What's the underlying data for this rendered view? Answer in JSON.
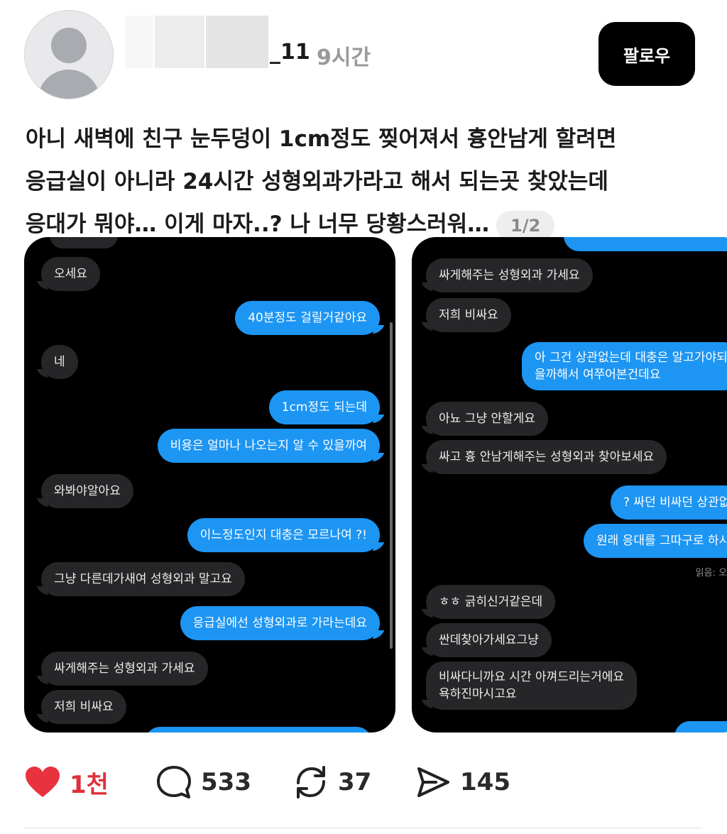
{
  "header": {
    "username": "_11",
    "time_ago": "9시간",
    "follow_label": "팔로우"
  },
  "post": {
    "lines": [
      "아니 새벽에 친구 눈두덩이 1cm정도 찢어져서 흉안남게 할려면",
      "응급실이 아니라 24시간 성형외과가라고 해서 되는곳 찾았는데",
      "응대가 뭐야… 이게 마자..? 나 너무 당황스러워…"
    ],
    "page_indicator": "1/2"
  },
  "screenshot1": {
    "messages": [
      {
        "side": "recv",
        "text": "오세요"
      },
      {
        "side": "sent",
        "text": "40분정도 걸릴거같아요"
      },
      {
        "side": "recv",
        "text": "네"
      },
      {
        "side": "sent",
        "text": "1cm정도 되는데"
      },
      {
        "side": "sent",
        "text": "비용은 얼마나 나오는지 알 수 있을까여"
      },
      {
        "side": "recv",
        "text": "와봐야알아요"
      },
      {
        "side": "sent",
        "text": "이느정도인지 대충은 모르나여 ?!"
      },
      {
        "side": "recv",
        "text": "그냥 다른데가새여 성형외과 말고요"
      },
      {
        "side": "sent",
        "text": "응급실에선 성형외과로 가라는데요"
      },
      {
        "side": "recv",
        "text": "싸게해주는 성형외과 가세요"
      },
      {
        "side": "recv",
        "text": "저희 비싸요"
      }
    ]
  },
  "screenshot2": {
    "messages": [
      {
        "side": "recv",
        "text": "싸게해주는 성형외과 가세요"
      },
      {
        "side": "recv",
        "text": "저희 비싸요"
      },
      {
        "side": "sent",
        "text": "아 그건 상관없는데 대충은 알고가야되"
      },
      {
        "side": "sent",
        "text": "을까해서 여쭈어본건데요"
      },
      {
        "side": "recv",
        "text": "아뇨 그냥 안할게요"
      },
      {
        "side": "recv",
        "text": "싸고 흉 안남게해주는 성형외과 찾아보세요"
      },
      {
        "side": "sent",
        "text": "? 싸던 비싸던 상관없"
      },
      {
        "side": "sent",
        "text": "원래 응대를 그따구로 하시"
      },
      {
        "side": "recv",
        "text": "ㅎㅎ 긁히신거같은데"
      },
      {
        "side": "recv",
        "text": "싼데찾아가세요그냥"
      },
      {
        "side": "recv",
        "text": "비싸다니까요 시간 아껴드리는거에요"
      },
      {
        "side": "recv",
        "text": "욕하진마시고요"
      }
    ],
    "read_receipt": "읽음: 오전"
  },
  "actions": {
    "like_count": "1천",
    "comment_count": "533",
    "repost_count": "37",
    "share_count": "145",
    "like_color": "#e8333f"
  }
}
